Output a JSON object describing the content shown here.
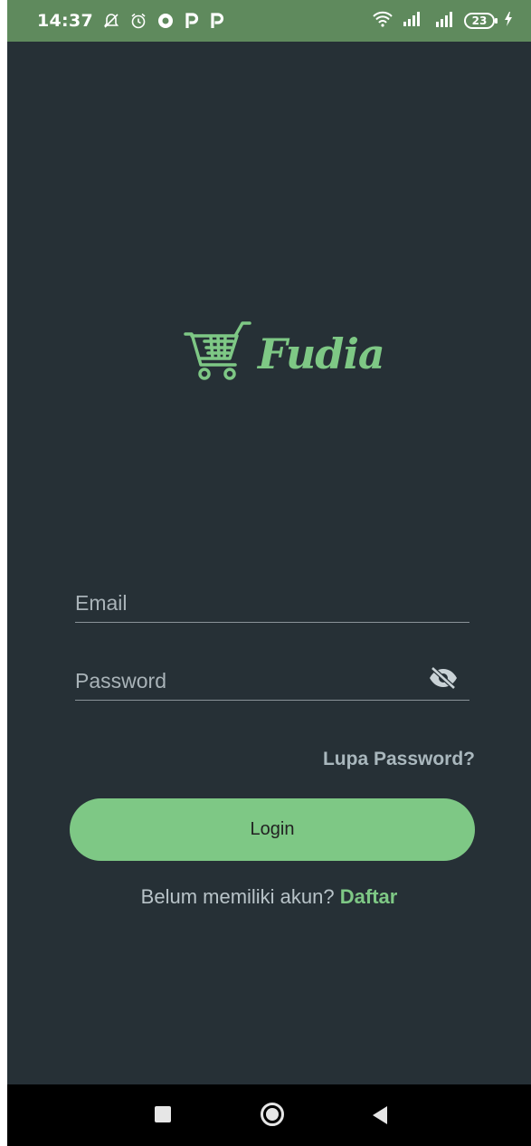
{
  "status_bar": {
    "time": "14:37",
    "left_icons": [
      "mute-icon",
      "alarm-icon",
      "opera-icon",
      "p-app-icon",
      "p-app-icon"
    ],
    "right_icons": [
      "wifi-icon",
      "signal-icon",
      "signal-4g-icon"
    ],
    "battery_level": "23"
  },
  "app": {
    "logo_text": "Fudia",
    "email_placeholder": "Email",
    "password_placeholder": "Password",
    "forgot_label": "Lupa Password?",
    "login_label": "Login",
    "signup_prompt": "Belum memiliki akun?",
    "signup_link": "Daftar"
  },
  "colors": {
    "background": "#263036",
    "accent": "#7ec885",
    "status_bar": "#5f8a5d"
  }
}
